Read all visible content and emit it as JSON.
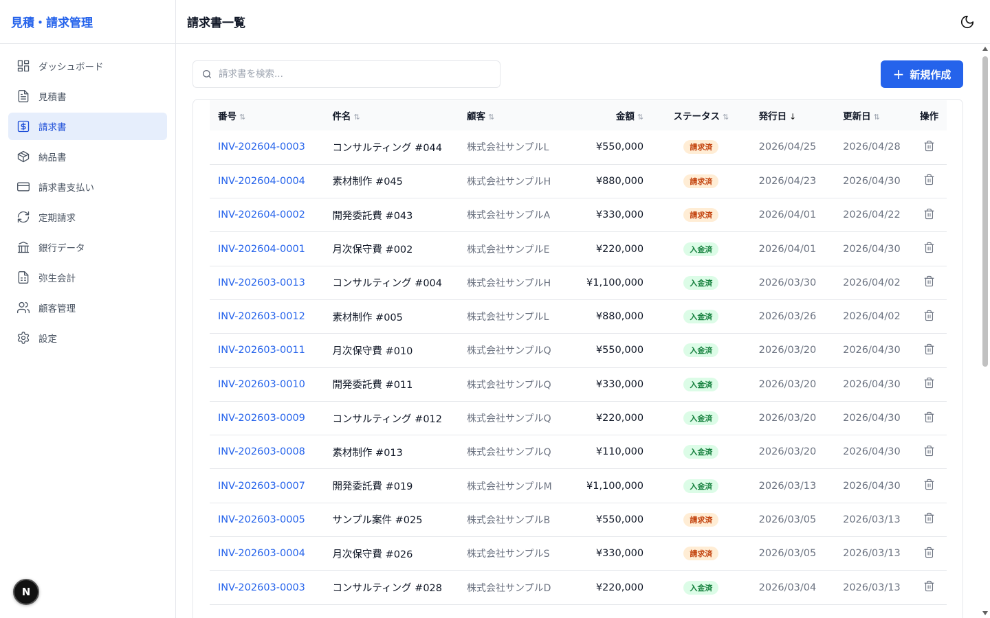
{
  "app": {
    "title": "見積・請求管理"
  },
  "sidebar": {
    "items": [
      {
        "label": "ダッシュボード",
        "icon": "dashboard-icon",
        "active": false
      },
      {
        "label": "見積書",
        "icon": "document-icon",
        "active": false
      },
      {
        "label": "請求書",
        "icon": "invoice-icon",
        "active": true
      },
      {
        "label": "納品書",
        "icon": "package-icon",
        "active": false
      },
      {
        "label": "請求書支払い",
        "icon": "credit-card-icon",
        "active": false
      },
      {
        "label": "定期請求",
        "icon": "refresh-icon",
        "active": false
      },
      {
        "label": "銀行データ",
        "icon": "bank-icon",
        "active": false
      },
      {
        "label": "弥生会計",
        "icon": "spreadsheet-icon",
        "active": false
      },
      {
        "label": "顧客管理",
        "icon": "users-icon",
        "active": false
      },
      {
        "label": "設定",
        "icon": "gear-icon",
        "active": false
      }
    ],
    "badge": "N"
  },
  "header": {
    "title": "請求書一覧",
    "theme_icon": "moon-icon"
  },
  "search": {
    "placeholder": "請求書を検索..."
  },
  "toolbar": {
    "new_label": "新規作成"
  },
  "table": {
    "columns": [
      "番号",
      "件名",
      "顧客",
      "金額",
      "ステータス",
      "発行日",
      "更新日",
      "操作"
    ],
    "rows": [
      {
        "number": "INV-202604-0003",
        "subject": "コンサルティング #044",
        "client": "株式会社サンプルL",
        "amount": "¥550,000",
        "status": "請求済",
        "issued": "2026/04/25",
        "updated": "2026/04/28"
      },
      {
        "number": "INV-202604-0004",
        "subject": "素材制作 #045",
        "client": "株式会社サンプルH",
        "amount": "¥880,000",
        "status": "請求済",
        "issued": "2026/04/23",
        "updated": "2026/04/30"
      },
      {
        "number": "INV-202604-0002",
        "subject": "開発委託費 #043",
        "client": "株式会社サンプルA",
        "amount": "¥330,000",
        "status": "請求済",
        "issued": "2026/04/01",
        "updated": "2026/04/22"
      },
      {
        "number": "INV-202604-0001",
        "subject": "月次保守費 #002",
        "client": "株式会社サンプルE",
        "amount": "¥220,000",
        "status": "入金済",
        "issued": "2026/04/01",
        "updated": "2026/04/30"
      },
      {
        "number": "INV-202603-0013",
        "subject": "コンサルティング #004",
        "client": "株式会社サンプルH",
        "amount": "¥1,100,000",
        "status": "入金済",
        "issued": "2026/03/30",
        "updated": "2026/04/02"
      },
      {
        "number": "INV-202603-0012",
        "subject": "素材制作 #005",
        "client": "株式会社サンプルL",
        "amount": "¥880,000",
        "status": "入金済",
        "issued": "2026/03/26",
        "updated": "2026/04/02"
      },
      {
        "number": "INV-202603-0011",
        "subject": "月次保守費 #010",
        "client": "株式会社サンプルQ",
        "amount": "¥550,000",
        "status": "入金済",
        "issued": "2026/03/20",
        "updated": "2026/04/30"
      },
      {
        "number": "INV-202603-0010",
        "subject": "開発委託費 #011",
        "client": "株式会社サンプルQ",
        "amount": "¥330,000",
        "status": "入金済",
        "issued": "2026/03/20",
        "updated": "2026/04/30"
      },
      {
        "number": "INV-202603-0009",
        "subject": "コンサルティング #012",
        "client": "株式会社サンプルQ",
        "amount": "¥220,000",
        "status": "入金済",
        "issued": "2026/03/20",
        "updated": "2026/04/30"
      },
      {
        "number": "INV-202603-0008",
        "subject": "素材制作 #013",
        "client": "株式会社サンプルQ",
        "amount": "¥110,000",
        "status": "入金済",
        "issued": "2026/03/20",
        "updated": "2026/04/30"
      },
      {
        "number": "INV-202603-0007",
        "subject": "開発委託費 #019",
        "client": "株式会社サンプルM",
        "amount": "¥1,100,000",
        "status": "入金済",
        "issued": "2026/03/13",
        "updated": "2026/04/30"
      },
      {
        "number": "INV-202603-0005",
        "subject": "サンプル案件 #025",
        "client": "株式会社サンプルB",
        "amount": "¥550,000",
        "status": "請求済",
        "issued": "2026/03/05",
        "updated": "2026/03/13"
      },
      {
        "number": "INV-202603-0004",
        "subject": "月次保守費 #026",
        "client": "株式会社サンプルS",
        "amount": "¥330,000",
        "status": "請求済",
        "issued": "2026/03/05",
        "updated": "2026/03/13"
      },
      {
        "number": "INV-202603-0003",
        "subject": "コンサルティング #028",
        "client": "株式会社サンプルD",
        "amount": "¥220,000",
        "status": "入金済",
        "issued": "2026/03/04",
        "updated": "2026/03/13"
      }
    ]
  },
  "colors": {
    "accent": "#2563eb",
    "billed_bg": "#ffedd5",
    "billed_text": "#c2410c",
    "paid_bg": "#dcfce7",
    "paid_text": "#15803d"
  }
}
